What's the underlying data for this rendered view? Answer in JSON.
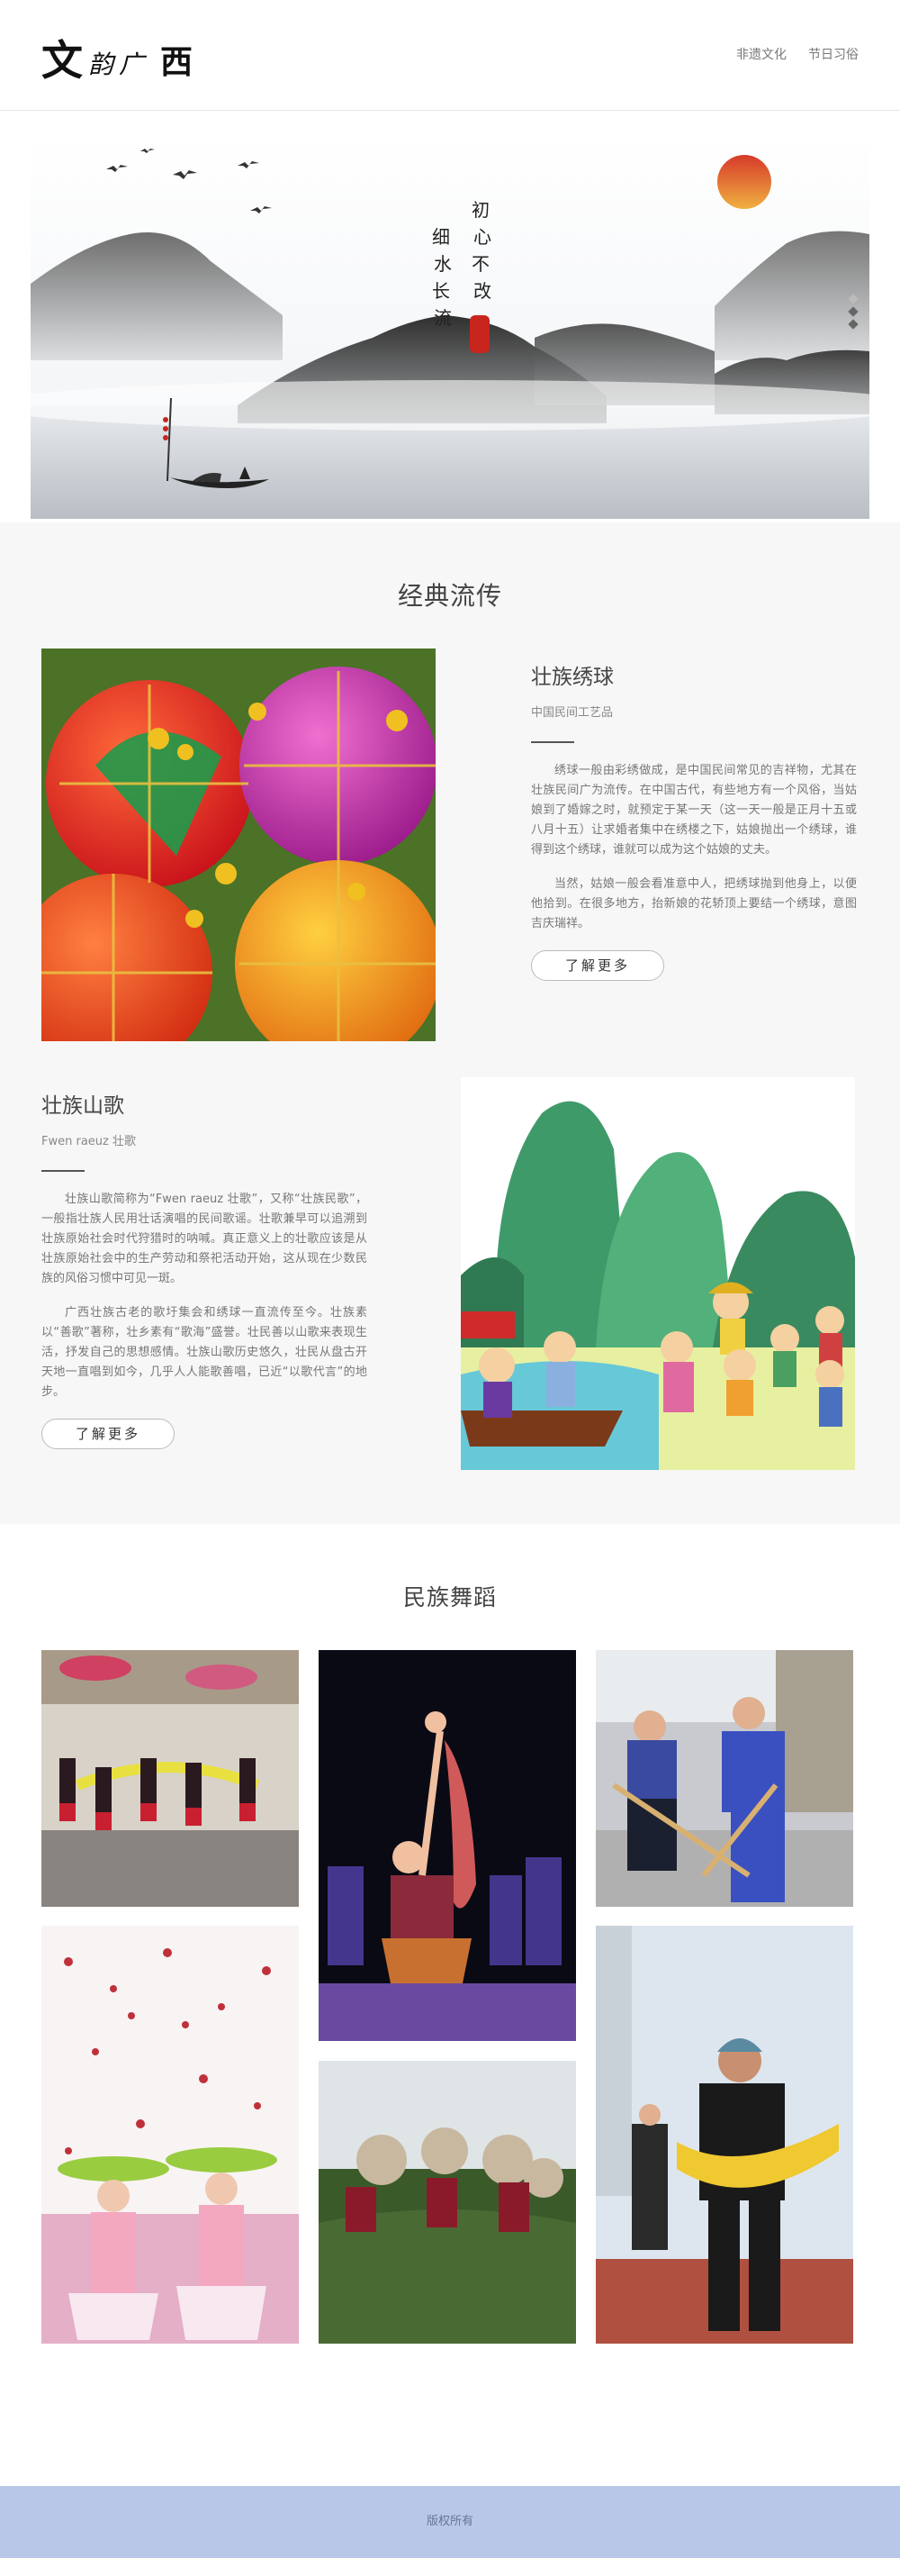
{
  "header": {
    "logo": {
      "c1": "文",
      "c2": "韵",
      "c3": "广",
      "c4": "西"
    },
    "nav": [
      "非遗文化",
      "节日习俗"
    ]
  },
  "hero": {
    "calligraphy": [
      "初心不改",
      "细水长流"
    ],
    "seal_text": "印",
    "dots": 3
  },
  "classics": {
    "title": "经典流传",
    "item1": {
      "title": "壮族绣球",
      "subtitle": "中国民间工艺品",
      "paragraphs": [
        "绣球一般由彩绣做成，是中国民间常见的吉祥物，尤其在壮族民间广为流传。在中国古代，有些地方有一个风俗，当姑娘到了婚嫁之时，就预定于某一天（这一天一般是正月十五或八月十五）让求婚者集中在绣楼之下，姑娘抛出一个绣球，谁得到这个绣球，谁就可以成为这个姑娘的丈夫。",
        "当然，姑娘一般会看准意中人，把绣球抛到他身上，以便他拾到。在很多地方，抬新娘的花轿顶上要结一个绣球，意图吉庆瑞祥。"
      ],
      "button": "了解更多"
    },
    "item2": {
      "title": "壮族山歌",
      "subtitle": "Fwen raeuz 壮歌",
      "paragraphs": [
        "壮族山歌简称为“Fwen raeuz 壮歌”，又称“壮族民歌”，一般指壮族人民用壮话演唱的民间歌谣。壮歌兼早可以追溯到壮族原始社会时代狩猎时的呐喊。真正意义上的壮歌应该是从壮族原始社会中的生产劳动和祭祀活动开始，这从现在少数民族的风俗习惯中可见一斑。",
        "广西壮族古老的歌圩集会和绣球一直流传至今。壮族素以“善歌”著称，壮乡素有“歌海”盛誉。壮民善以山歌来表现生活，抒发自己的思想感情。壮族山歌历史悠久，壮民从盘古开天地一直唱到如今，几乎人人能歌善唱，已近“以歌代言”的地步。"
      ],
      "button": "了解更多"
    }
  },
  "dance": {
    "title": "民族舞蹈"
  },
  "footer": {
    "text": "版权所有"
  },
  "colors": {
    "footer_bg": "#b8c7e8",
    "hero_sun": "#d63a2a",
    "section_bg": "#f7f7f7"
  }
}
